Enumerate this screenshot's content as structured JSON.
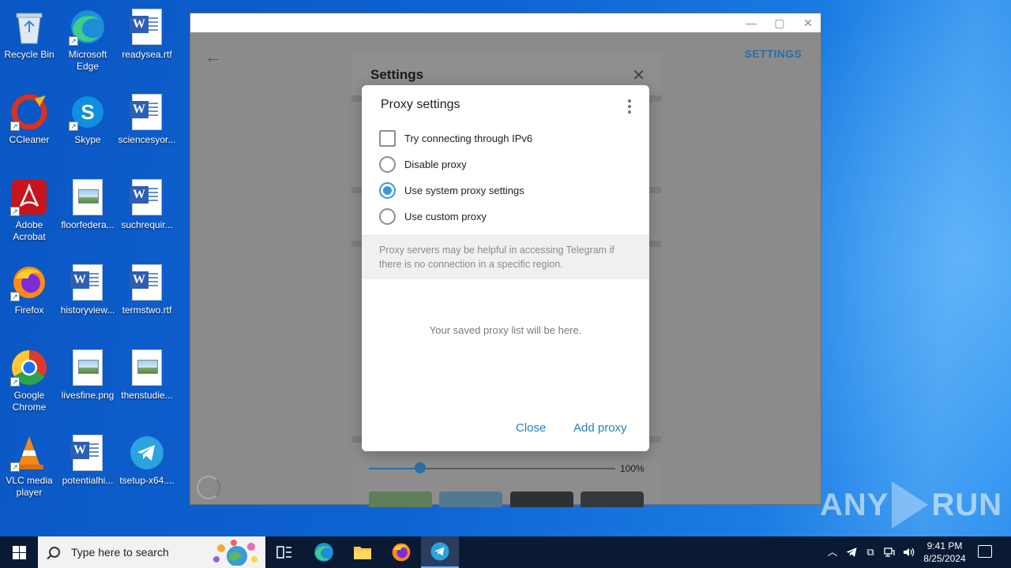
{
  "desktop": {
    "icons": [
      {
        "label": "Recycle Bin"
      },
      {
        "label": "Microsoft Edge"
      },
      {
        "label": "readysea.rtf"
      },
      {
        "label": "CCleaner"
      },
      {
        "label": "Skype"
      },
      {
        "label": "sciencesyor..."
      },
      {
        "label": "Adobe Acrobat"
      },
      {
        "label": "floorfedera..."
      },
      {
        "label": "suchrequir..."
      },
      {
        "label": "Firefox"
      },
      {
        "label": "historyview..."
      },
      {
        "label": "termstwo.rtf"
      },
      {
        "label": "Google Chrome"
      },
      {
        "label": "livesfine.png"
      },
      {
        "label": "thenstudie..."
      },
      {
        "label": "VLC media player"
      },
      {
        "label": "potentialhi..."
      },
      {
        "label": "tsetup-x64...."
      }
    ]
  },
  "app": {
    "settings_link": "SETTINGS",
    "settings_panel": {
      "title": "Settings",
      "zoom_value": "100%",
      "zoom_fraction": 0.21
    }
  },
  "proxy_dialog": {
    "title": "Proxy settings",
    "options": [
      {
        "type": "checkbox",
        "label": "Try connecting through IPv6",
        "checked": false
      },
      {
        "type": "radio",
        "label": "Disable proxy",
        "checked": false
      },
      {
        "type": "radio",
        "label": "Use system proxy settings",
        "checked": true
      },
      {
        "type": "radio",
        "label": "Use custom proxy",
        "checked": false
      }
    ],
    "info_text": "Proxy servers may be helpful in accessing Telegram if there is no connection in a specific region.",
    "empty_text": "Your saved proxy list will be here.",
    "close_label": "Close",
    "add_label": "Add proxy",
    "accent_color": "#3a9ad8"
  },
  "watermark": {
    "text_left": "ANY",
    "text_right": "RUN"
  },
  "taskbar": {
    "search_placeholder": "Type here to search",
    "clock_time": "9:41 PM",
    "clock_date": "8/25/2024"
  }
}
